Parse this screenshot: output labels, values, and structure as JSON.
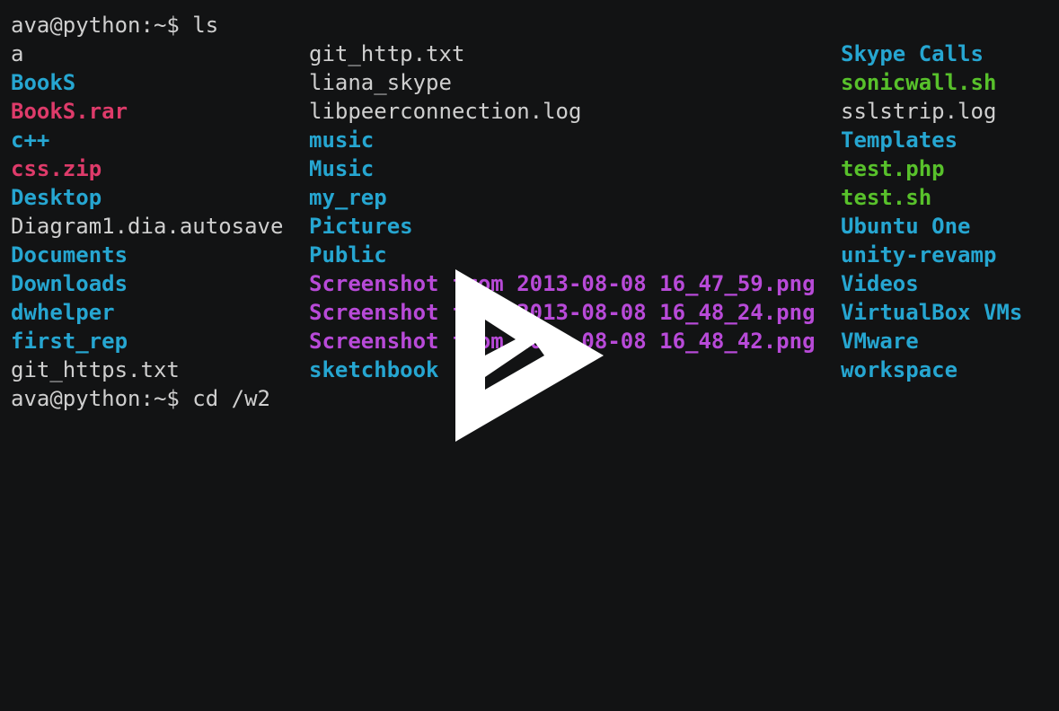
{
  "terminal": {
    "prompt": "ava@python:~$ ",
    "command1": "ls",
    "command2": "cd /w2",
    "listing": {
      "col1": [
        {
          "name": "a",
          "type": "file"
        },
        {
          "name": "BookS",
          "type": "dir"
        },
        {
          "name": "BookS.rar",
          "type": "archive"
        },
        {
          "name": "c++",
          "type": "dir"
        },
        {
          "name": "css.zip",
          "type": "archive"
        },
        {
          "name": "Desktop",
          "type": "dir"
        },
        {
          "name": "Diagram1.dia.autosave",
          "type": "file"
        },
        {
          "name": "Documents",
          "type": "dir"
        },
        {
          "name": "Downloads",
          "type": "dir"
        },
        {
          "name": "dwhelper",
          "type": "dir"
        },
        {
          "name": "first_rep",
          "type": "dir"
        },
        {
          "name": "git_https.txt",
          "type": "file"
        }
      ],
      "col2": [
        {
          "name": "git_http.txt",
          "type": "file"
        },
        {
          "name": "liana_skype",
          "type": "file"
        },
        {
          "name": "libpeerconnection.log",
          "type": "file"
        },
        {
          "name": "music",
          "type": "dir"
        },
        {
          "name": "Music",
          "type": "dir"
        },
        {
          "name": "my_rep",
          "type": "dir"
        },
        {
          "name": "Pictures",
          "type": "dir"
        },
        {
          "name": "Public",
          "type": "dir"
        },
        {
          "name": "Screenshot from 2013-08-08 16_47_59.png",
          "type": "image"
        },
        {
          "name": "Screenshot from 2013-08-08 16_48_24.png",
          "type": "image"
        },
        {
          "name": "Screenshot from 2013-08-08 16_48_42.png",
          "type": "image"
        },
        {
          "name": "sketchbook",
          "type": "dir"
        }
      ],
      "col3": [
        {
          "name": "Skype Calls",
          "type": "dir"
        },
        {
          "name": "sonicwall.sh",
          "type": "exec"
        },
        {
          "name": "sslstrip.log",
          "type": "file"
        },
        {
          "name": "Templates",
          "type": "dir"
        },
        {
          "name": "test.php",
          "type": "exec"
        },
        {
          "name": "test.sh",
          "type": "exec"
        },
        {
          "name": "Ubuntu One",
          "type": "dir"
        },
        {
          "name": "unity-revamp",
          "type": "dir"
        },
        {
          "name": "Videos",
          "type": "dir"
        },
        {
          "name": "VirtualBox VMs",
          "type": "dir"
        },
        {
          "name": "VMware",
          "type": "dir"
        },
        {
          "name": "workspace",
          "type": "dir"
        }
      ]
    }
  },
  "overlay": {
    "icon": "play-icon"
  },
  "colors": {
    "background": "#121314",
    "file": "#cfcfcf",
    "directory": "#26a6d1",
    "archive": "#de3b6a",
    "executable": "#58c12b",
    "image": "#b84ad8"
  }
}
